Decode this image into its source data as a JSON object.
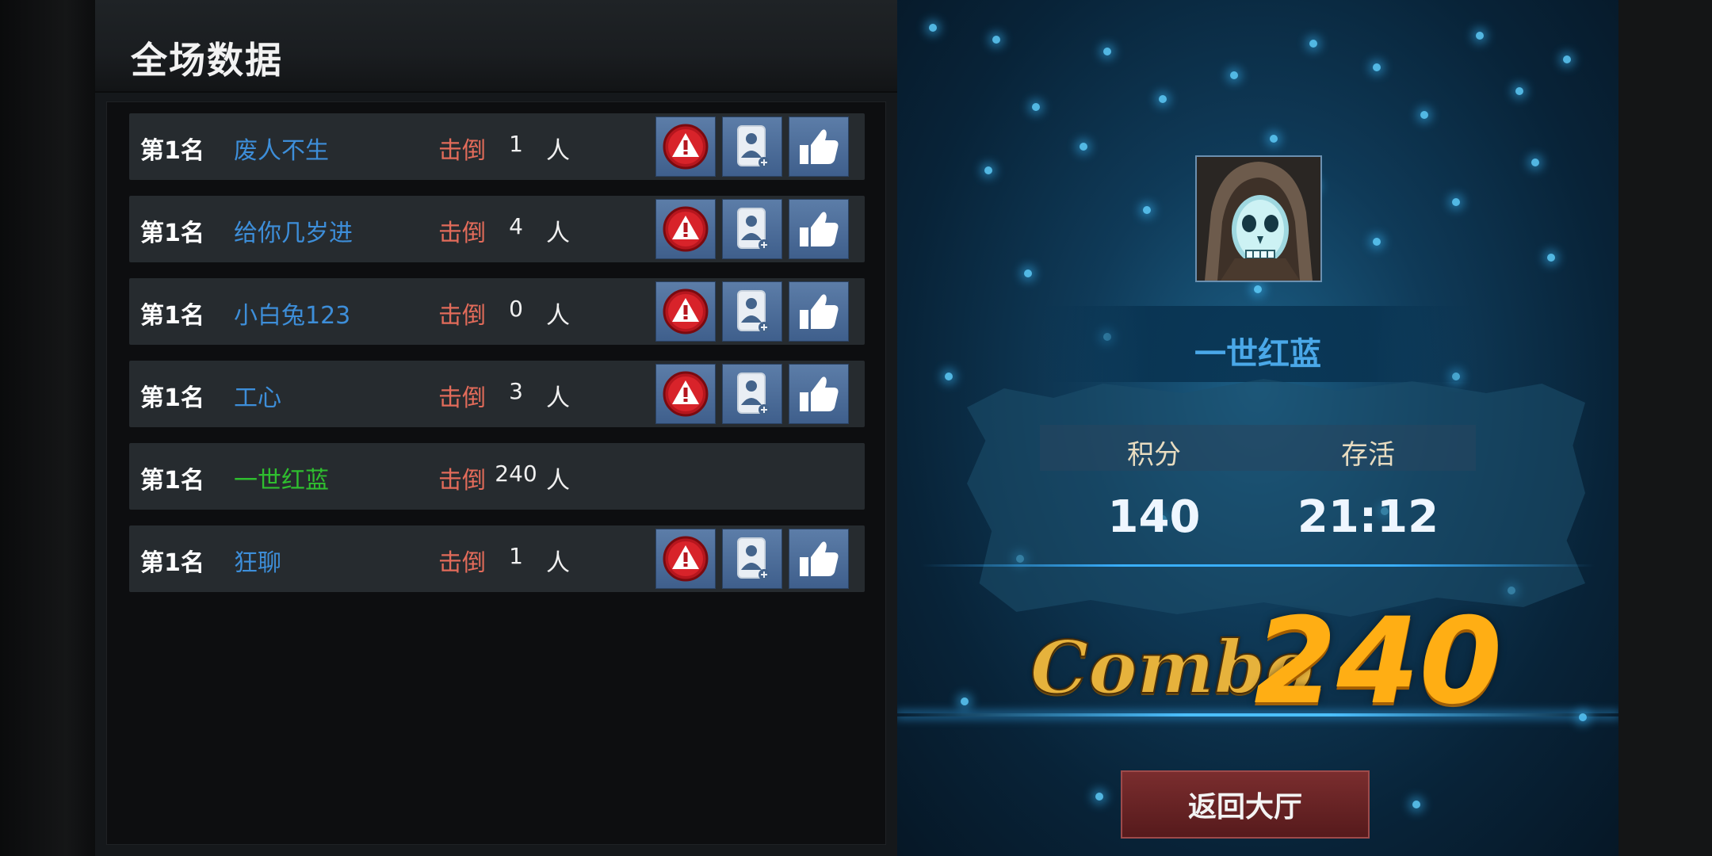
{
  "panel_title": "全场数据",
  "players": [
    {
      "rank": "第1名",
      "name": "废人不生",
      "kill_label": "击倒",
      "kills": "1",
      "unit": "人",
      "is_self": false
    },
    {
      "rank": "第1名",
      "name": "给你几岁进",
      "kill_label": "击倒",
      "kills": "4",
      "unit": "人",
      "is_self": false
    },
    {
      "rank": "第1名",
      "name": "小白兔123",
      "kill_label": "击倒",
      "kills": "0",
      "unit": "人",
      "is_self": false
    },
    {
      "rank": "第1名",
      "name": "工心",
      "kill_label": "击倒",
      "kills": "3",
      "unit": "人",
      "is_self": false
    },
    {
      "rank": "第1名",
      "name": "一世红蓝",
      "kill_label": "击倒",
      "kills": "240",
      "unit": "人",
      "is_self": true
    },
    {
      "rank": "第1名",
      "name": "狂聊",
      "kill_label": "击倒",
      "kills": "1",
      "unit": "人",
      "is_self": false
    }
  ],
  "row_icons": [
    "warning-icon",
    "add-friend-icon",
    "thumbs-up-icon"
  ],
  "result": {
    "player_name": "一世红蓝",
    "score_label": "积分",
    "score_value": "140",
    "survival_label": "存活",
    "survival_value": "21:12",
    "combo_label": "Combo",
    "combo_value": "240"
  },
  "back_button": "返回大厅",
  "colors": {
    "enemy_name": "#3d8ed9",
    "self_name": "#2fbe2f",
    "kill_label": "#e26b5a",
    "combo": "#ffae14",
    "back_button": "#6b2426"
  }
}
